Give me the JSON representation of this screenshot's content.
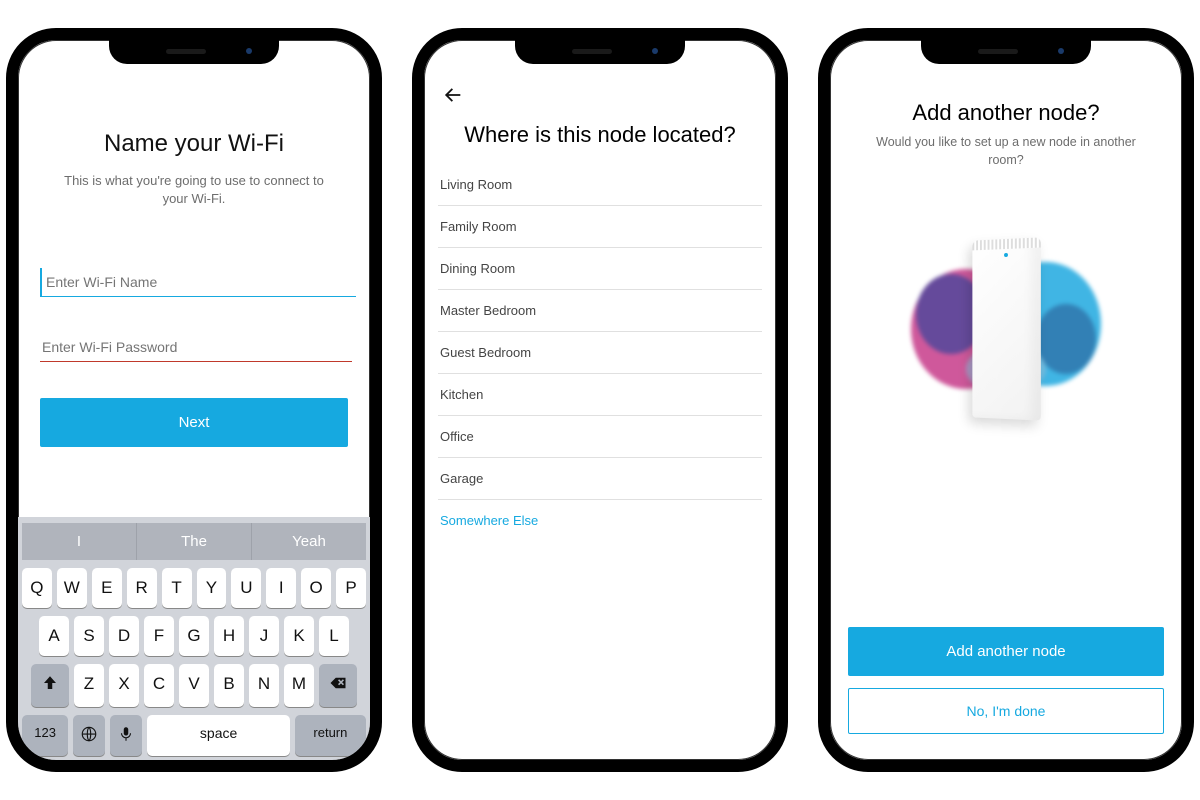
{
  "screen1": {
    "title": "Name your Wi-Fi",
    "subtitle": "This is what you're going to use to connect to your Wi-Fi.",
    "wifi_name_placeholder": "Enter Wi-Fi Name",
    "wifi_password_placeholder": "Enter Wi-Fi Password",
    "next_label": "Next",
    "keyboard": {
      "suggestions": [
        "I",
        "The",
        "Yeah"
      ],
      "row1": [
        "Q",
        "W",
        "E",
        "R",
        "T",
        "Y",
        "U",
        "I",
        "O",
        "P"
      ],
      "row2": [
        "A",
        "S",
        "D",
        "F",
        "G",
        "H",
        "J",
        "K",
        "L"
      ],
      "row3": [
        "Z",
        "X",
        "C",
        "V",
        "B",
        "N",
        "M"
      ],
      "shift_icon": "shift-icon",
      "backspace_icon": "backspace-icon",
      "numbers_label": "123",
      "emoji_icon": "globe-icon",
      "mic_icon": "mic-icon",
      "space_label": "space",
      "return_label": "return"
    }
  },
  "screen2": {
    "back_icon": "back-arrow-icon",
    "title": "Where is this node located?",
    "locations": [
      "Living Room",
      "Family Room",
      "Dining Room",
      "Master Bedroom",
      "Guest Bedroom",
      "Kitchen",
      "Office",
      "Garage"
    ],
    "somewhere_else": "Somewhere Else"
  },
  "screen3": {
    "title": "Add another node?",
    "subtitle": "Would you like to set up a new node in another room?",
    "add_label": "Add another node",
    "done_label": "No, I'm done"
  }
}
